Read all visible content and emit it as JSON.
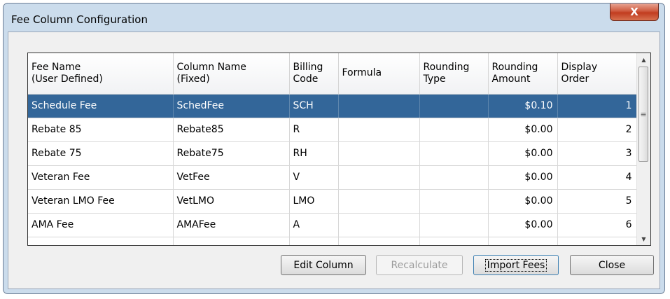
{
  "window": {
    "title": "Fee Column Configuration",
    "close_label": "X"
  },
  "grid": {
    "headers": [
      {
        "line1": "Fee Name",
        "line2": "(User Defined)"
      },
      {
        "line1": "Column Name",
        "line2": "(Fixed)"
      },
      {
        "line1": "Billing",
        "line2": "Code"
      },
      {
        "line1": "Formula",
        "line2": ""
      },
      {
        "line1": "Rounding",
        "line2": "Type"
      },
      {
        "line1": "Rounding",
        "line2": "Amount"
      },
      {
        "line1": "Display",
        "line2": "Order"
      }
    ],
    "rows": [
      {
        "fee_name": "Schedule Fee",
        "column_name": "SchedFee",
        "billing_code": "SCH",
        "formula": "",
        "rounding_type": "",
        "rounding_amount": "$0.10",
        "display_order": "1",
        "selected": true
      },
      {
        "fee_name": "Rebate 85",
        "column_name": "Rebate85",
        "billing_code": "R",
        "formula": "",
        "rounding_type": "",
        "rounding_amount": "$0.00",
        "display_order": "2",
        "selected": false
      },
      {
        "fee_name": "Rebate 75",
        "column_name": "Rebate75",
        "billing_code": "RH",
        "formula": "",
        "rounding_type": "",
        "rounding_amount": "$0.00",
        "display_order": "3",
        "selected": false
      },
      {
        "fee_name": "Veteran Fee",
        "column_name": "VetFee",
        "billing_code": "V",
        "formula": "",
        "rounding_type": "",
        "rounding_amount": "$0.00",
        "display_order": "4",
        "selected": false
      },
      {
        "fee_name": "Veteran LMO Fee",
        "column_name": "VetLMO",
        "billing_code": "LMO",
        "formula": "",
        "rounding_type": "",
        "rounding_amount": "$0.00",
        "display_order": "5",
        "selected": false
      },
      {
        "fee_name": "AMA Fee",
        "column_name": "AMAFee",
        "billing_code": "A",
        "formula": "",
        "rounding_type": "",
        "rounding_amount": "$0.00",
        "display_order": "6",
        "selected": false
      }
    ],
    "scrollbar": {
      "up_icon": "▲",
      "down_icon": "▼",
      "grip_icon": "≡"
    }
  },
  "buttons": {
    "edit_column": "Edit Column",
    "recalculate": "Recalculate",
    "import_fees": "Import Fees",
    "close": "Close"
  }
}
